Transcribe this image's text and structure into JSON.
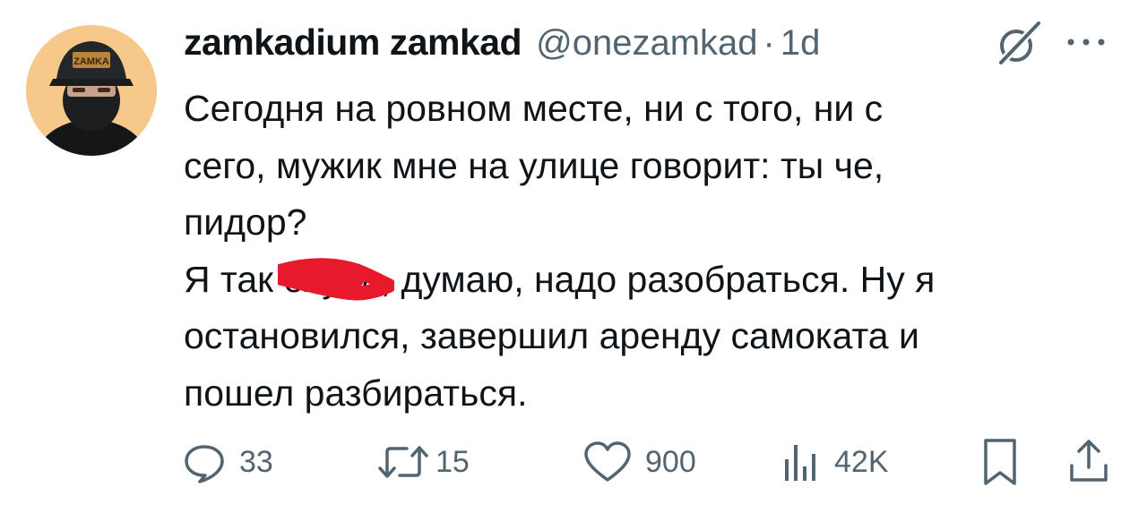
{
  "tweet": {
    "display_name": "zamkadium zamkad",
    "handle": "@onezamkad",
    "separator": "·",
    "timestamp": "1d",
    "avatar_cap_text": "ZAMKA",
    "text_lines": [
      "Сегодня на ровном месте, ни с того, ни с",
      "сего, мужик мне на улице говорит: ты че,",
      "пидор?"
    ],
    "line4_before": "Я так ",
    "line4_censored": "охуел",
    "line4_after": ", думаю, надо разобраться. Ну я",
    "line5": "остановился, завершил аренду самоката и",
    "line6": "пошел разбираться."
  },
  "actions": {
    "replies": "33",
    "reposts": "15",
    "likes": "900",
    "views": "42K"
  },
  "icons": {
    "reply": "reply-icon",
    "repost": "repost-icon",
    "like": "heart-icon",
    "views": "views-icon",
    "bookmark": "bookmark-icon",
    "share": "share-icon",
    "grok": "grok-icon",
    "more": "more-icon"
  },
  "colors": {
    "text": "#0f1419",
    "secondary": "#536471",
    "scribble": "#e8192c"
  }
}
